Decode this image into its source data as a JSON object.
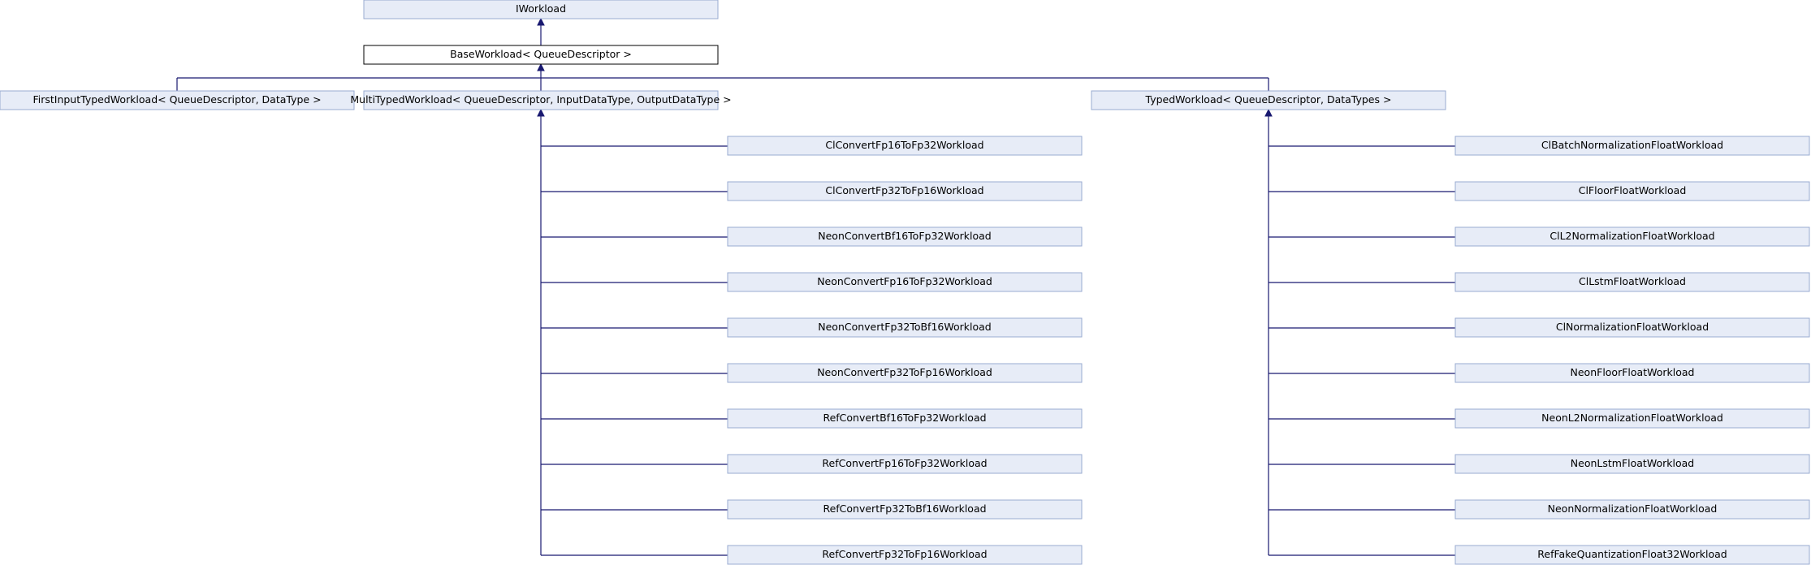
{
  "nodes": {
    "iworkload": "IWorkload",
    "base_workload": "BaseWorkload< QueueDescriptor >",
    "first_input_typed": "FirstInputTypedWorkload< QueueDescriptor, DataType >",
    "multi_typed": "MultiTypedWorkload< QueueDescriptor, InputDataType, OutputDataType >",
    "typed": "TypedWorkload< QueueDescriptor, DataTypes >"
  },
  "multi_typed_children": [
    "ClConvertFp16ToFp32Workload",
    "ClConvertFp32ToFp16Workload",
    "NeonConvertBf16ToFp32Workload",
    "NeonConvertFp16ToFp32Workload",
    "NeonConvertFp32ToBf16Workload",
    "NeonConvertFp32ToFp16Workload",
    "RefConvertBf16ToFp32Workload",
    "RefConvertFp16ToFp32Workload",
    "RefConvertFp32ToBf16Workload",
    "RefConvertFp32ToFp16Workload"
  ],
  "typed_children": [
    "ClBatchNormalizationFloatWorkload",
    "ClFloorFloatWorkload",
    "ClL2NormalizationFloatWorkload",
    "ClLstmFloatWorkload",
    "ClNormalizationFloatWorkload",
    "NeonFloorFloatWorkload",
    "NeonL2NormalizationFloatWorkload",
    "NeonLstmFloatWorkload",
    "NeonNormalizationFloatWorkload",
    "RefFakeQuantizationFloat32Workload"
  ],
  "colors": {
    "node_fill": "#e7ecf7",
    "node_border": "#9aabd0",
    "edge": "#191970",
    "base_border": "#000000"
  }
}
